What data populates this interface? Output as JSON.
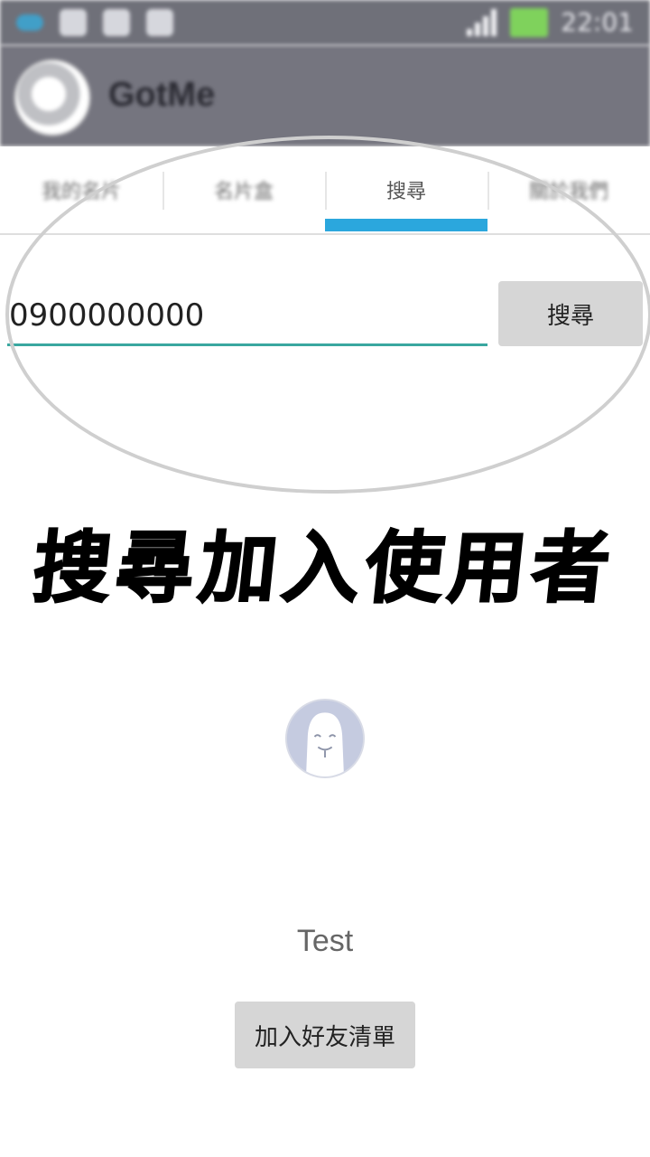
{
  "status_bar": {
    "time": "22:01"
  },
  "app_bar": {
    "title": "GotMe"
  },
  "tabs": [
    {
      "label": "我的名片"
    },
    {
      "label": "名片盒"
    },
    {
      "label": "搜尋"
    },
    {
      "label": "關於我們"
    }
  ],
  "active_tab_index": 2,
  "search": {
    "value": "0900000000",
    "button_label": "搜尋"
  },
  "annotation": {
    "caption": "搜尋加入使用者"
  },
  "result": {
    "name": "Test",
    "add_button_label": "加入好友清單"
  },
  "colors": {
    "app_bar": "#75757f",
    "tab_indicator": "#2ba7dd",
    "input_underline": "#3aa7a0",
    "button_bg": "#d6d6d6",
    "avatar_bg": "#c5cbe0"
  }
}
